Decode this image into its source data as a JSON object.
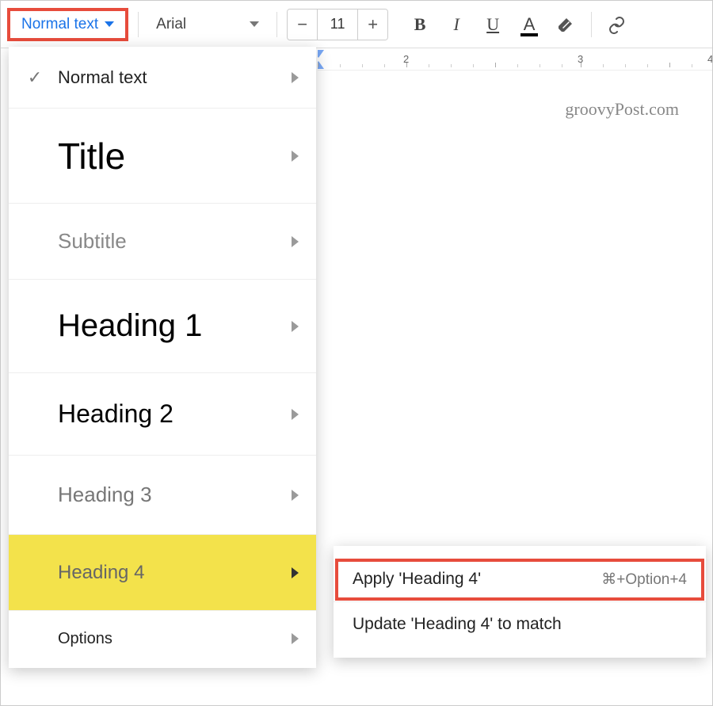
{
  "toolbar": {
    "style_dropdown_label": "Normal text",
    "font_dropdown_label": "Arial",
    "font_size": "11"
  },
  "ruler": {
    "n1": "2",
    "n2": "3",
    "n3": "4"
  },
  "watermark": "groovyPost.com",
  "styles_menu": {
    "normal": "Normal text",
    "title": "Title",
    "subtitle": "Subtitle",
    "h1": "Heading 1",
    "h2": "Heading 2",
    "h3": "Heading 3",
    "h4": "Heading 4",
    "options": "Options"
  },
  "submenu": {
    "apply_label": "Apply 'Heading 4'",
    "apply_shortcut": "⌘+Option+4",
    "update_label": "Update 'Heading 4' to match"
  }
}
